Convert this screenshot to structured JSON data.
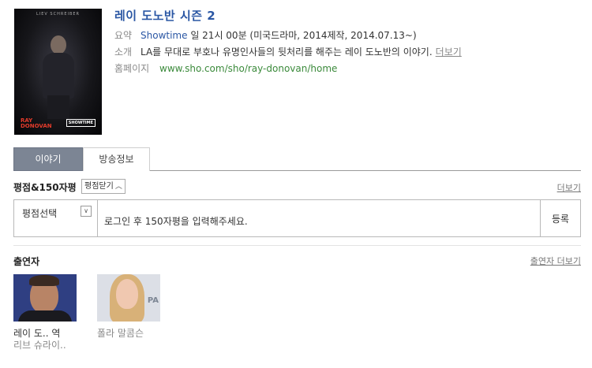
{
  "poster": {
    "top_text": "LIEV SCHREIBER",
    "title_line1": "RAY",
    "title_line2": "DONOVAN",
    "network": "SHOWTIME"
  },
  "info": {
    "title": "레이 도노반 시즌 2",
    "summary_label": "요약",
    "channel": "Showtime",
    "summary_text": " 일 21시 00분 (미국드라마, 2014제작, 2014.07.13~)",
    "desc_label": "소개",
    "desc_text": "LA를 무대로 부호나 유명인사들의 뒷처리를 해주는 레이 도노반의 이야기.",
    "desc_more": "더보기",
    "home_label": "홈페이지",
    "home_url": "www.sho.com/sho/ray-donovan/home"
  },
  "tabs": {
    "story": "이야기",
    "broadcast": "방송정보"
  },
  "rating": {
    "title": "평점&150자평",
    "fold_button": "평점닫기",
    "more": "더보기",
    "select_label": "평점선택",
    "input_placeholder": "로그인 후 150자평을 입력해주세요.",
    "submit": "등록"
  },
  "cast": {
    "title": "출연자",
    "more": "출연자 더보기",
    "members": [
      {
        "name": "레이 도.. 역",
        "actor": "리브 슈라이.."
      },
      {
        "name": "폴라 말콤슨",
        "actor": ""
      }
    ],
    "photo_text": "PA"
  }
}
